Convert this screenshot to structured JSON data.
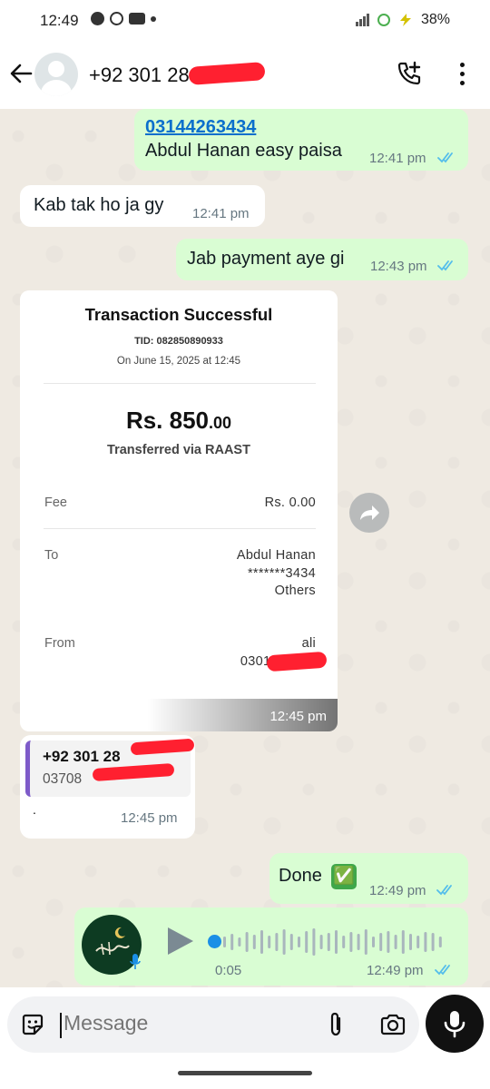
{
  "status_bar": {
    "time": "12:49",
    "battery": "38%"
  },
  "header": {
    "contact_name": "+92 301 28"
  },
  "messages": {
    "m1": {
      "link": "03144263434",
      "text": "Abdul Hanan easy paisa",
      "time": "12:41 pm"
    },
    "m2": {
      "text": "Kab tak ho ja gy",
      "time": "12:41 pm"
    },
    "m3": {
      "text": "Jab payment aye gi",
      "time": "12:43 pm"
    },
    "receipt": {
      "title": "Transaction Successful",
      "tid": "TID: 082850890933",
      "date": "On June 15, 2025 at 12:45",
      "amount_main": "Rs. 850",
      "amount_decimal": ".00",
      "via": "Transferred via RAAST",
      "fee_label": "Fee",
      "fee_value": "Rs. 0.00",
      "to_label": "To",
      "to_name": "Abdul Hanan",
      "to_account": "*******3434",
      "to_bank": "Others",
      "from_label": "From",
      "from_name": "ali",
      "from_account": "030113",
      "time": "12:45 pm"
    },
    "contact_card": {
      "name": "+92 301 28",
      "number": "03708",
      "note": ".",
      "time": "12:45 pm"
    },
    "m_done": {
      "text": "Done",
      "emoji": "✅",
      "time": "12:49 pm"
    },
    "voice": {
      "duration": "0:05",
      "time": "12:49 pm",
      "progress": 0
    }
  },
  "composer": {
    "placeholder": "Message"
  },
  "colors": {
    "outgoing": "#d9fdd3",
    "incoming": "#ffffff",
    "tick_read": "#53bdeb",
    "redaction": "#ff2030"
  },
  "icons": [
    "back-arrow-icon",
    "add-call-icon",
    "more-options-icon",
    "forward-icon",
    "play-icon",
    "mic-icon",
    "sticker-icon",
    "attach-icon",
    "camera-icon",
    "read-ticks-icon"
  ]
}
